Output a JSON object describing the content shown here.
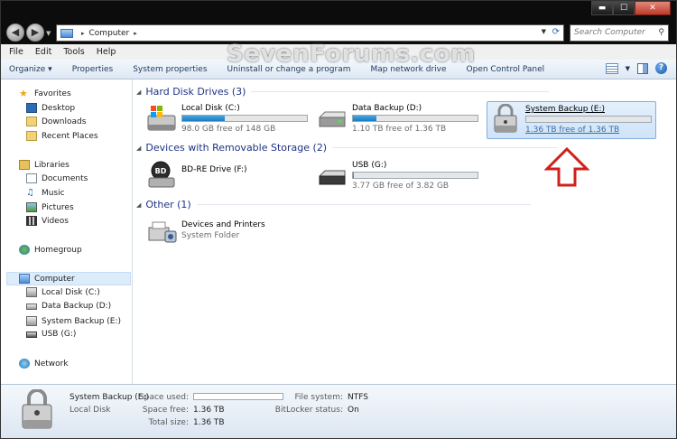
{
  "window": {
    "caption_buttons": {
      "minimize": "▬",
      "maximize": "☐",
      "close": "✕"
    }
  },
  "address": {
    "path": [
      "Computer"
    ],
    "search_placeholder": "Search Computer"
  },
  "watermark": "SevenForums.com",
  "menu": [
    "File",
    "Edit",
    "Tools",
    "Help"
  ],
  "toolbar": {
    "items": [
      "Organize ▾",
      "Properties",
      "System properties",
      "Uninstall or change a program",
      "Map network drive",
      "Open Control Panel"
    ]
  },
  "nav": {
    "favorites": {
      "label": "Favorites",
      "items": [
        "Desktop",
        "Downloads",
        "Recent Places"
      ]
    },
    "libraries": {
      "label": "Libraries",
      "items": [
        "Documents",
        "Music",
        "Pictures",
        "Videos"
      ]
    },
    "homegroup": "Homegroup",
    "computer": {
      "label": "Computer",
      "items": [
        "Local Disk (C:)",
        "Data Backup (D:)",
        "System Backup (E:)",
        "USB (G:)"
      ]
    },
    "network": "Network"
  },
  "groups": {
    "hdd": "Hard Disk Drives (3)",
    "removable": "Devices with Removable Storage (2)",
    "other": "Other (1)"
  },
  "drives": {
    "c": {
      "name": "Local Disk (C:)",
      "free": "98.0 GB free of 148 GB",
      "used_fraction": 0.34
    },
    "d": {
      "name": "Data Backup (D:)",
      "free": "1.10 TB free of 1.36 TB",
      "used_fraction": 0.19
    },
    "e": {
      "name": "System Backup (E:)",
      "free": "1.36 TB free of 1.36 TB",
      "used_fraction": 0.0
    },
    "f": {
      "name": "BD-RE Drive (F:)",
      "icon_text": "BD"
    },
    "g": {
      "name": "USB (G:)",
      "free": "3.77 GB free of 3.82 GB",
      "used_fraction": 0.01
    },
    "printers": {
      "name": "Devices and Printers",
      "sub": "System Folder"
    }
  },
  "details": {
    "name": "System Backup (E:)",
    "type": "Local Disk",
    "space_used_label": "Space used:",
    "space_free_label": "Space free:",
    "space_free": "1.36 TB",
    "total_size_label": "Total size:",
    "total_size": "1.36 TB",
    "fs_label": "File system:",
    "fs": "NTFS",
    "bitlocker_label": "BitLocker status:",
    "bitlocker": "On"
  },
  "colors": {
    "accent_bar": "#1d7bc2",
    "arrow": "#d0201a",
    "group_heading": "#1e3287"
  }
}
